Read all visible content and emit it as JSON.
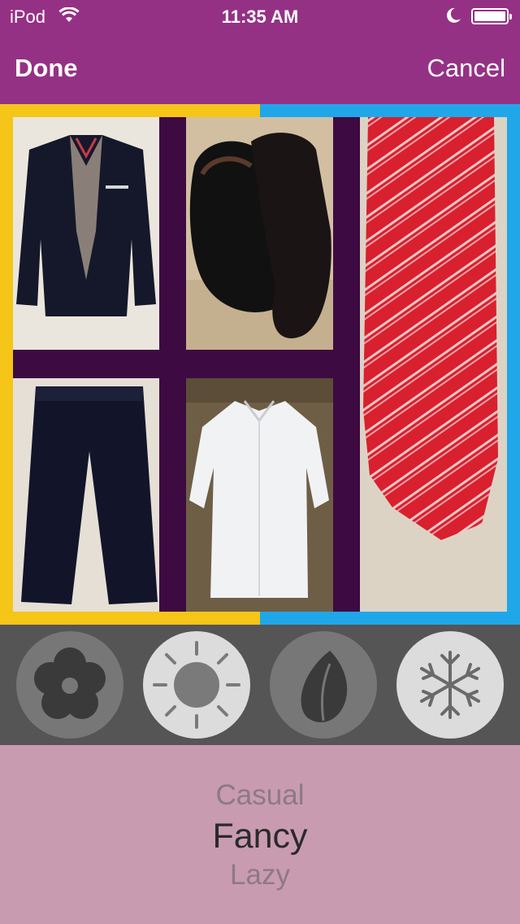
{
  "status_bar": {
    "carrier": "iPod",
    "time": "11:35 AM"
  },
  "nav": {
    "done_label": "Done",
    "cancel_label": "Cancel"
  },
  "collage": {
    "items": [
      {
        "name": "blazer",
        "icon": "blazer-photo"
      },
      {
        "name": "shoes",
        "icon": "shoes-photo"
      },
      {
        "name": "tie",
        "icon": "tie-photo"
      },
      {
        "name": "pants",
        "icon": "pants-photo"
      },
      {
        "name": "shirt",
        "icon": "shirt-photo"
      }
    ],
    "colors": {
      "left_frame": "#f5c518",
      "right_frame": "#1fa7e9",
      "inner": "#3e0a42"
    }
  },
  "seasons": [
    {
      "icon": "flower-icon",
      "selected": false
    },
    {
      "icon": "sun-icon",
      "selected": true
    },
    {
      "icon": "leaf-icon",
      "selected": false
    },
    {
      "icon": "snowflake-icon",
      "selected": true
    }
  ],
  "picker": {
    "options": [
      "Casual",
      "Fancy",
      "Lazy"
    ],
    "selected": "Fancy"
  },
  "colors": {
    "nav": "#953185",
    "background": "#c99bb0",
    "season_bar": "#555555"
  }
}
